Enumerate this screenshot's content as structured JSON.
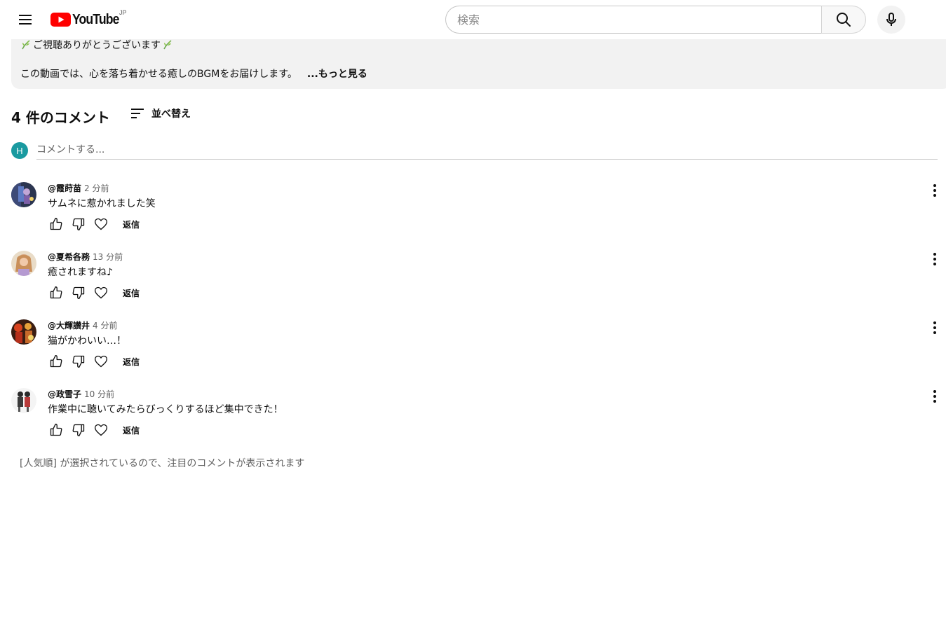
{
  "header": {
    "logo_text": "YouTube",
    "region": "JP",
    "search_placeholder": "検索"
  },
  "description": {
    "line1": "ご視聴ありがとうございます",
    "line2": "この動画では、心を落ち着かせる癒しのBGMをお届けします。",
    "more_label": "...もっと見る"
  },
  "comments_header": {
    "count_label": "4 件のコメント",
    "sort_label": "並べ替え"
  },
  "add_comment": {
    "avatar_letter": "H",
    "placeholder": "コメントする..."
  },
  "comments": [
    {
      "author": "@霞莳苗",
      "time": "2 分前",
      "text": "サムネに惹かれました笑",
      "reply_label": "返信"
    },
    {
      "author": "@夏希各務",
      "time": "13 分前",
      "text": "癒されますね♪",
      "reply_label": "返信"
    },
    {
      "author": "@大輝讃井",
      "time": "4 分前",
      "text": "猫がかわいい…！",
      "reply_label": "返信"
    },
    {
      "author": "@政雪子",
      "time": "10 分前",
      "text": "作業中に聴いてみたらびっくりするほど集中できた！",
      "reply_label": "返信"
    }
  ],
  "footer_note": "[人気順] が選択されているので、注目のコメントが表示されます",
  "colors": {
    "brand_red": "#ff0000",
    "description_bg": "#f2f2f2",
    "my_avatar": "#1a9aa0",
    "secondary_text": "#606060"
  }
}
